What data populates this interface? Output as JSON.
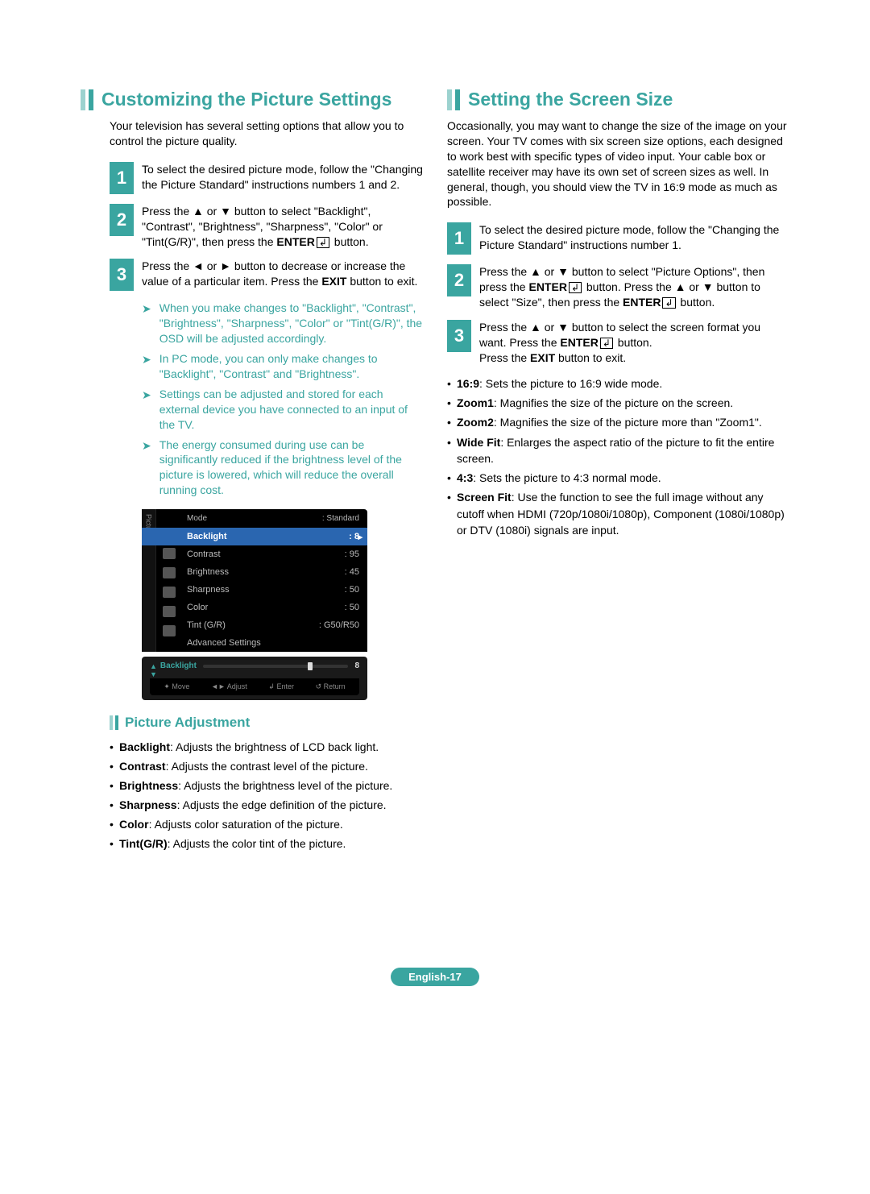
{
  "left": {
    "title": "Customizing the Picture Settings",
    "intro": "Your television has several setting options that allow you to control the picture quality.",
    "steps": [
      {
        "num": "1",
        "text": "To select the desired picture mode, follow the \"Changing the Picture Standard\" instructions numbers 1 and 2."
      },
      {
        "num": "2",
        "pre": "Press the ▲ or ▼ button to select \"Backlight\", \"Contrast\", \"Brightness\", \"Sharpness\", \"Color\" or \"Tint(G/R)\", then press the ",
        "bold": "ENTER",
        "post": " button."
      },
      {
        "num": "3",
        "pre": "Press the ◄ or ► button to decrease or increase the value of a particular item. Press the ",
        "bold": "EXIT",
        "post": " button to exit."
      }
    ],
    "notes": [
      "When you make changes to \"Backlight\", \"Contrast\", \"Brightness\", \"Sharpness\", \"Color\" or \"Tint(G/R)\", the OSD will be adjusted accordingly.",
      "In PC mode, you can only make changes to \"Backlight\", \"Contrast\" and \"Brightness\".",
      "Settings can be adjusted and stored for each external device you have connected to an input of the TV.",
      "The energy consumed during use can be significantly reduced if the brightness level of the picture is lowered, which will reduce the overall running cost."
    ],
    "osd": {
      "side": "Picture",
      "mode_label": "Mode",
      "mode_value": ": Standard",
      "rows": [
        {
          "label": "Backlight",
          "value": ": 8",
          "selected": true
        },
        {
          "label": "Contrast",
          "value": ": 95"
        },
        {
          "label": "Brightness",
          "value": ": 45"
        },
        {
          "label": "Sharpness",
          "value": ": 50"
        },
        {
          "label": "Color",
          "value": ": 50"
        },
        {
          "label": "Tint (G/R)",
          "value": ": G50/R50"
        },
        {
          "label": "Advanced Settings",
          "value": ""
        }
      ],
      "slider": {
        "label": "Backlight",
        "value": "8"
      },
      "hints": [
        "✦ Move",
        "◄► Adjust",
        "↲ Enter",
        "↺ Return"
      ]
    },
    "adjust": {
      "title": "Picture Adjustment",
      "items": [
        {
          "b": "Backlight",
          "t": ": Adjusts the brightness of LCD back light."
        },
        {
          "b": "Contrast",
          "t": ": Adjusts the contrast level of the picture."
        },
        {
          "b": "Brightness",
          "t": ": Adjusts the brightness level of the picture."
        },
        {
          "b": "Sharpness",
          "t": ": Adjusts the edge definition of the picture."
        },
        {
          "b": "Color",
          "t": ": Adjusts color saturation of the picture."
        },
        {
          "b": "Tint(G/R)",
          "t": ": Adjusts the color tint of the picture."
        }
      ]
    }
  },
  "right": {
    "title": "Setting the Screen Size",
    "intro": "Occasionally, you may want to change the size of the image on your screen. Your TV comes with six screen size options, each designed to work best with specific types of video input. Your cable box or satellite receiver may have its own set of screen sizes as well. In general, though, you should view the TV in 16:9 mode as much as possible.",
    "steps": [
      {
        "num": "1",
        "text": "To select the desired picture mode, follow the \"Changing the Picture Standard\" instructions number 1."
      },
      {
        "num": "2",
        "pre": "Press the ▲ or ▼ button to select \"Picture Options\", then press the ",
        "bold": "ENTER",
        "post1": " button. Press the ▲ or ▼ button to select \"Size\", then press the ",
        "bold2": "ENTER",
        "post2": " button."
      },
      {
        "num": "3",
        "pre": "Press the ▲ or ▼ button to select the screen format you want. Press the ",
        "bold": "ENTER",
        "post1": " button.",
        "line2a": "Press the ",
        "line2bold": "EXIT",
        "line2b": " button to exit."
      }
    ],
    "defs": [
      {
        "b": "16:9",
        "t": ": Sets the picture to 16:9 wide mode."
      },
      {
        "b": "Zoom1",
        "t": ": Magnifies the size of the picture on the screen."
      },
      {
        "b": "Zoom2",
        "t": ": Magnifies the size of the picture more than \"Zoom1\"."
      },
      {
        "b": "Wide Fit",
        "t": ": Enlarges the aspect ratio of the picture to fit the entire screen."
      },
      {
        "b": "4:3",
        "t": ": Sets the picture to 4:3 normal mode."
      },
      {
        "b": "Screen Fit",
        "t": ": Use the function to see the full image without any cutoff when HDMI (720p/1080i/1080p), Component (1080i/1080p) or DTV (1080i) signals are input."
      }
    ]
  },
  "page": "English-17"
}
